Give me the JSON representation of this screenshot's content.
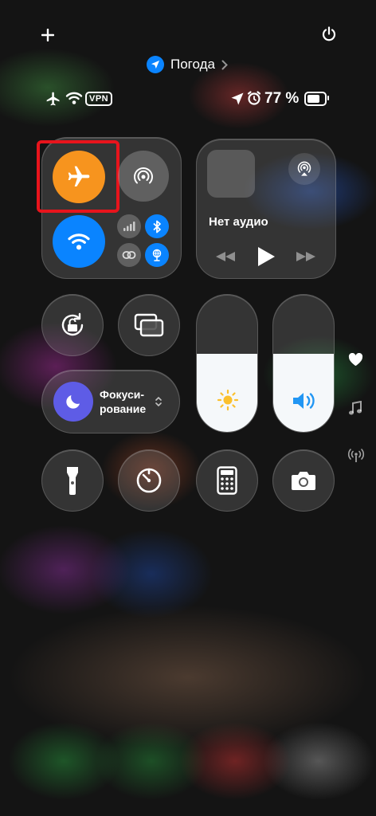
{
  "status_bar": {
    "vpn_label": "VPN",
    "battery_text": "77 %",
    "battery_level": 0.77,
    "icons": [
      "airplane-icon",
      "wifi-icon",
      "location-arrow-icon",
      "alarm-icon",
      "battery-icon"
    ]
  },
  "top_bar": {
    "add_icon": "plus-icon",
    "power_icon": "power-icon",
    "location_label": "Погода"
  },
  "connectivity": {
    "airplane_mode": true,
    "wifi": true,
    "bluetooth": true,
    "colors": {
      "airplane": "#f7941e",
      "active_blue": "#0a84ff"
    }
  },
  "media": {
    "title": "Нет аудио"
  },
  "focus": {
    "label_line1": "Фокуси-",
    "label_line2": "рование"
  },
  "sliders": {
    "brightness_level": 0.57,
    "volume_level": 0.57
  },
  "bottom_controls": [
    "flashlight-icon",
    "timer-icon",
    "calculator-icon",
    "camera-icon"
  ],
  "side_icons": [
    "heart-icon",
    "music-note-icon",
    "antenna-icon"
  ]
}
